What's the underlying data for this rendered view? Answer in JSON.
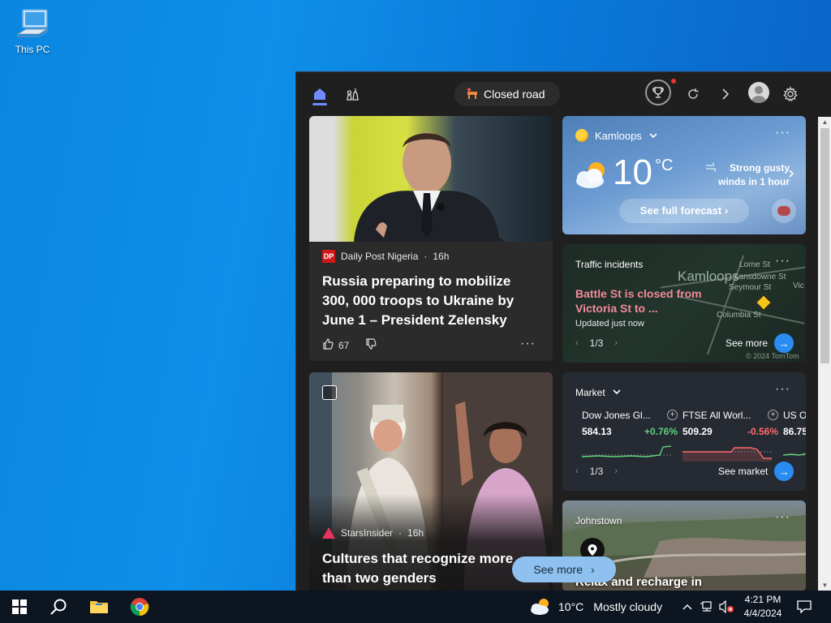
{
  "desktop": {
    "this_pc_label": "This PC"
  },
  "widgets": {
    "topbar": {
      "closed_road_label": "Closed road"
    },
    "news": [
      {
        "source": "Daily Post Nigeria",
        "source_logo": "DP",
        "age": "16h",
        "headline": "Russia preparing to mobilize 300, 000 troops to Ukraine by June 1 – President Zelensky",
        "likes": "67"
      },
      {
        "source": "StarsInsider",
        "age": "16h",
        "headline": "Cultures that recognize more than two genders"
      }
    ],
    "weather": {
      "location": "Kamloops",
      "temperature": "10",
      "unit": "°C",
      "alert": "Strong gusty winds in 1 hour",
      "forecast_button": "See full forecast"
    },
    "traffic": {
      "title": "Traffic incidents",
      "headline": "Battle St is closed from Victoria St to ...",
      "updated": "Updated just now",
      "page": "1/3",
      "see_more": "See more",
      "map_city": "Kamloops",
      "map_labels": [
        "Lorne St",
        "Lansdowne St",
        "Seymour St",
        "Columbia St",
        "Vic"
      ],
      "map_credit": "© 2024 TomTom"
    },
    "market": {
      "title": "Market",
      "stocks": [
        {
          "name": "Dow Jones Gl...",
          "value": "584.13",
          "change": "+0.76%"
        },
        {
          "name": "FTSE All Worl...",
          "value": "509.29",
          "change": "-0.56%"
        },
        {
          "name": "US O",
          "value": "86.75",
          "change": ""
        }
      ],
      "page": "1/3",
      "see_market": "See market"
    },
    "local": {
      "title": "Johnstown",
      "headline": "Relax and recharge in"
    },
    "see_more_pill": "See more",
    "colors": {
      "positive": "#5ed17a",
      "negative": "#ff6b6b",
      "accent": "#2a8cf0"
    }
  },
  "taskbar": {
    "weather_temp": "10°C",
    "weather_text": "Mostly cloudy",
    "time": "4:21 PM",
    "date": "4/4/2024"
  }
}
